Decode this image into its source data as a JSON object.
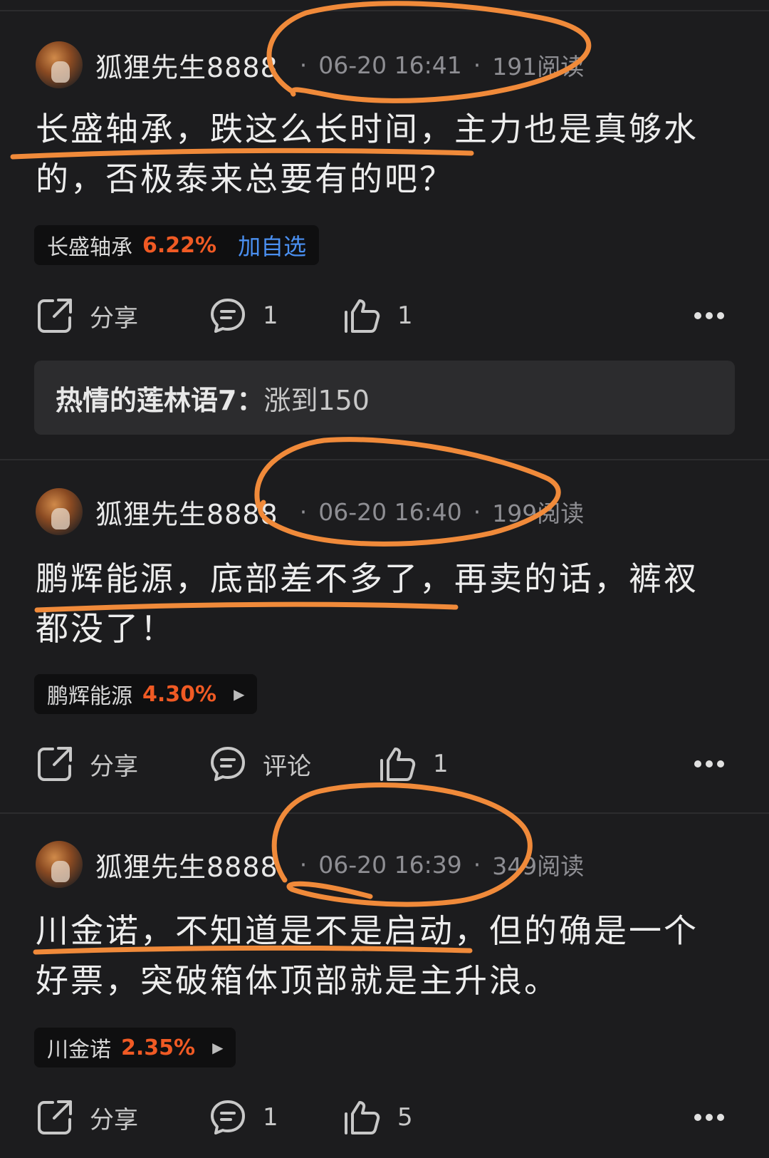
{
  "posts": [
    {
      "author": "狐狸先生8888",
      "date": "06-20 16:41",
      "reads": "191阅读",
      "content_line1": "长盛轴承，跌这么长时间，主力也是真够水",
      "content_line2": "的，否极泰来总要有的吧？",
      "stock": {
        "name": "长盛轴承",
        "change": "6.22%",
        "action": "加自选"
      },
      "share_label": "分享",
      "comment_label": "1",
      "like_count": "1",
      "reply": {
        "user": "热情的莲林语7：",
        "text": "涨到150"
      }
    },
    {
      "author": "狐狸先生8888",
      "date": "06-20 16:40",
      "reads": "199阅读",
      "content_line1": "鹏辉能源，底部差不多了，再卖的话，裤衩",
      "content_line2": "都没了！",
      "stock": {
        "name": "鹏辉能源",
        "change": "4.30%",
        "arrow": "▶"
      },
      "share_label": "分享",
      "comment_label": "评论",
      "like_count": "1"
    },
    {
      "author": "狐狸先生8888",
      "date": "06-20 16:39",
      "reads": "349阅读",
      "content_line1": "川金诺，不知道是不是启动，但的确是一个",
      "content_line2": "好票，突破箱体顶部就是主升浪。",
      "stock": {
        "name": "川金诺",
        "change": "2.35%",
        "arrow": "▶"
      },
      "share_label": "分享",
      "comment_label": "1",
      "like_count": "5"
    }
  ],
  "meta_separator": "·",
  "colors": {
    "background": "#1c1c1e",
    "stock_up": "#f05a24",
    "link_blue": "#4a8ff0",
    "annotation": "#f08a3a"
  },
  "icons": [
    "avatar",
    "share-icon",
    "comment-icon",
    "like-icon",
    "more-icon"
  ]
}
